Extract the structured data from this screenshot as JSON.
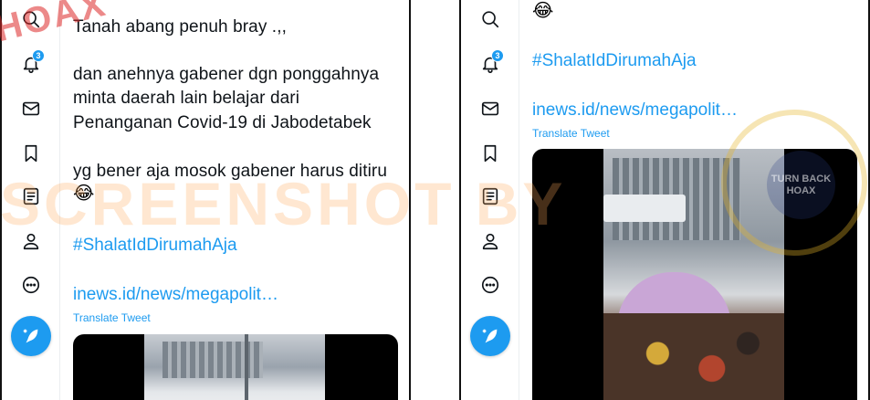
{
  "left": {
    "notification_count": "3",
    "tweet_lines": [
      "Tanah abang penuh bray .,,",
      "dan anehnya gabener dgn ponggahnya",
      "minta daerah lain belajar dari",
      "Penanganan Covid-19 di Jabodetabek",
      "yg bener aja mosok gabener harus ditiru"
    ],
    "emoji": "😂",
    "hashtag": "#ShalatIdDirumahAja",
    "link": "inews.id/news/megapolit…",
    "translate": "Translate Tweet"
  },
  "right": {
    "notification_count": "3",
    "emoji": "😂",
    "hashtag": "#ShalatIdDirumahAja",
    "link": "inews.id/news/megapolit…",
    "translate": "Translate Tweet"
  },
  "overlay": {
    "watermark": "SCREENSHOT BY",
    "stamp": "HOAX",
    "seal_text": "TURN BACK HOAX"
  },
  "icons": [
    "search-icon",
    "bell-icon",
    "mail-icon",
    "bookmark-icon",
    "list-icon",
    "profile-icon",
    "more-icon",
    "compose-icon"
  ],
  "colors": {
    "accent": "#1d9bf0",
    "text": "#0f1419",
    "border": "#111111"
  }
}
